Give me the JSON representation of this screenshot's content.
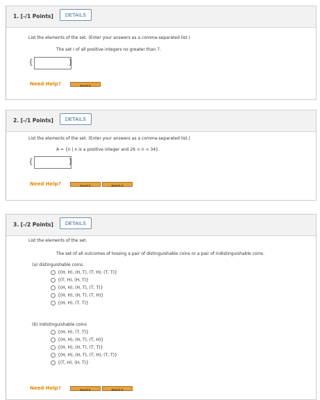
{
  "questions": [
    {
      "number": "1. [-/1 Points]",
      "details_label": "DETAILS",
      "instruction": "List the elements of the set. (Enter your answers as a comma-separated list.)",
      "statement": "The set I of all positive integers no greater than 7.",
      "open_brace": "{",
      "close_brace": "}",
      "answer_value": "",
      "need_help": "Need Help?",
      "read_it": "Read It"
    },
    {
      "number": "2. [-/1 Points]",
      "details_label": "DETAILS",
      "instruction": "List the elements of the set. (Enter your answers as a comma-separated list.)",
      "statement": "A = {n | n is a positive integer and 26 < n < 34}.",
      "open_brace": "{",
      "close_brace": "}",
      "answer_value": "",
      "need_help": "Need Help?",
      "read_it": "Read It",
      "watch_it": "Watch It"
    },
    {
      "number": "3. [-/2 Points]",
      "details_label": "DETAILS",
      "instruction": "List the elements of the set.",
      "statement": "The set of all outcomes of tossing a pair of distinguishable coins or a pair of indistinguishable coins.",
      "part_a": {
        "label": "(a)  distinguishable coins",
        "options": [
          "{(H, H), (H, T), (T, H), (T, T)}",
          "{(T, H), (H, T)}",
          "{(H, H), (H, T), (T, T)}",
          "{(H, H), (H, T), (T, H)}",
          "{(H, H), (T, T)}"
        ]
      },
      "part_b": {
        "label": "(b)  indistinguishable coins",
        "options": [
          "{(H, H), (T, T)}",
          "{(H, H), (H, T), (T, H)}",
          "{(H, H), (H, T), (T, T)}",
          "{(H, H), (H, T), (T, H), (T, T)}",
          "{(T, H), (H, T)}"
        ]
      },
      "need_help": "Need Help?",
      "read_it": "Read It",
      "watch_it": "Watch It"
    }
  ]
}
